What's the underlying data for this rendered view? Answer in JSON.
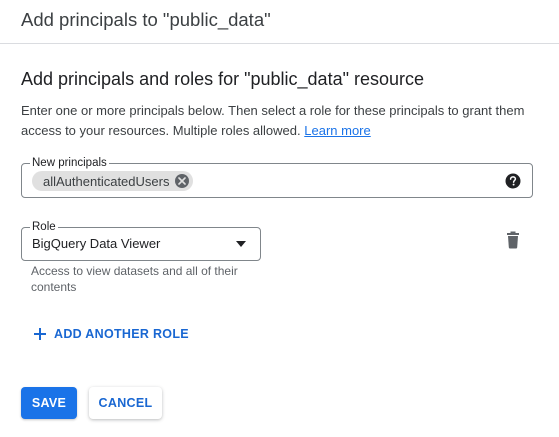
{
  "dialog": {
    "title": "Add principals to \"public_data\""
  },
  "section": {
    "title": "Add principals and roles for \"public_data\" resource",
    "description": "Enter one or more principals below. Then select a role for these principals to grant them access to your resources. Multiple roles allowed.",
    "learn_more": "Learn more"
  },
  "principals": {
    "label": "New principals",
    "chips": [
      "allAuthenticatedUsers"
    ],
    "help_icon": "help-circle-icon"
  },
  "role": {
    "label": "Role",
    "value": "BigQuery Data Viewer",
    "hint": "Access to view datasets and all of their contents",
    "delete_icon": "trash-icon"
  },
  "actions": {
    "add_role": "ADD ANOTHER ROLE",
    "save": "SAVE",
    "cancel": "CANCEL"
  },
  "colors": {
    "accent": "#1a73e8",
    "accent_text": "#1967d2",
    "border": "#80868b",
    "chip_bg": "#e0e0e0"
  }
}
